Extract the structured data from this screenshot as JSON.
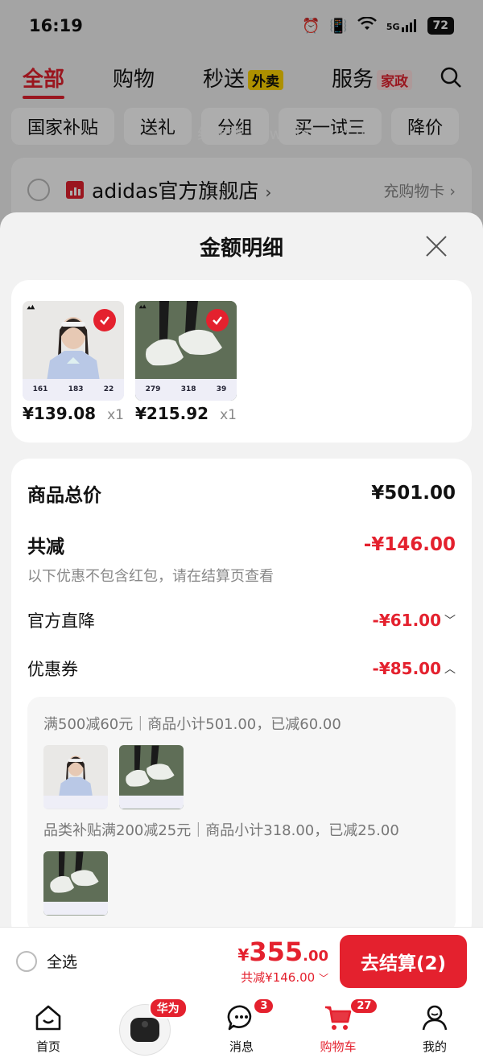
{
  "status_bar": {
    "time": "16:19",
    "battery": "72",
    "signal": "5G"
  },
  "top_tabs": [
    {
      "label": "全部",
      "active": true
    },
    {
      "label": "购物"
    },
    {
      "label": "秒送",
      "tag": "外卖"
    },
    {
      "label": "服务",
      "tag": "家政"
    }
  ],
  "watermark": "线报酷 new.xianbao.fun",
  "filter_chips": [
    "国家补贴",
    "送礼",
    "分组",
    "买一试三",
    "降价"
  ],
  "store": {
    "name": "adidas官方旗舰店",
    "name_chevron": "›",
    "card_link": "充购物卡 ›"
  },
  "sheet": {
    "title": "金额明细",
    "products": [
      {
        "price": "¥139.08",
        "qty": "x1",
        "image": "tshirt",
        "sizes": [
          "161",
          "183",
          "22"
        ]
      },
      {
        "price": "¥215.92",
        "qty": "x1",
        "image": "shoes",
        "sizes": [
          "279",
          "318",
          "39"
        ]
      }
    ],
    "total_label": "商品总价",
    "total_value": "¥501.00",
    "discount_label": "共减",
    "discount_value": "-¥146.00",
    "discount_note": "以下优惠不包含红包，请在结算页查看",
    "official_label": "官方直降",
    "official_value": "-¥61.00",
    "coupon_label": "优惠券",
    "coupon_value": "-¥85.00",
    "coupon_details": [
      {
        "text": "满500减60元｜商品小计501.00，已减60.00"
      },
      {
        "text": "品类补贴满200减25元｜商品小计318.00，已减25.00"
      }
    ]
  },
  "checkout": {
    "select_all": "全选",
    "currency": "¥",
    "total_int": "355",
    "total_dec": ".00",
    "saved": "共减¥146.00",
    "pay_button": "去结算(2)"
  },
  "bottom_nav": [
    {
      "label": "首页",
      "icon": "home-icon"
    },
    {
      "label": "",
      "icon": "earbuds-promo",
      "tag": "华为"
    },
    {
      "label": "消息",
      "icon": "message-icon",
      "badge": "3"
    },
    {
      "label": "购物车",
      "icon": "cart-icon",
      "badge": "27",
      "active": true
    },
    {
      "label": "我的",
      "icon": "profile-icon"
    }
  ],
  "colors": {
    "accent": "#e4212e",
    "background": "#f2f2f2"
  }
}
